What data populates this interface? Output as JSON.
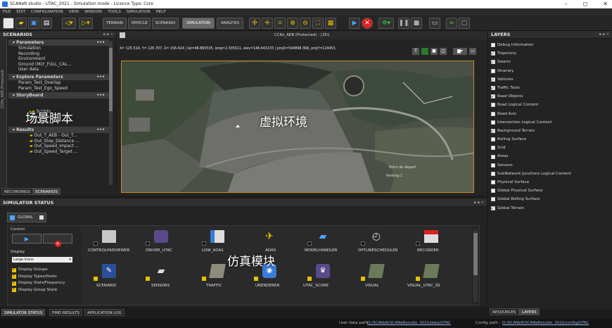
{
  "titlebar": {
    "text": "SCANeR studio - UTAC_2021 - Simulation mode - Licence Type: Core",
    "minimize": "–",
    "maximize": "◻",
    "close": "✕"
  },
  "menu": [
    "FILE",
    "EDIT",
    "CONFIGURATION",
    "VIEW",
    "WINDOW",
    "TOOLS",
    "SIMULATION",
    "HELP"
  ],
  "toolbar": {
    "modes": [
      "TERRAIN",
      "VEHICLE",
      "SCENARIO",
      "SIMULATION",
      "ANALYSIS"
    ],
    "active_mode": "SIMULATION"
  },
  "scenarios": {
    "title": "SCENARIOS",
    "side_label": "CCRs_AEB (Protected)",
    "parameters": {
      "label": "Parameters",
      "items": [
        "Simulation",
        "Recording",
        "Environment",
        "Ground (MLY_FULL_CAL...",
        "User data"
      ]
    },
    "explore": {
      "label": "Explore Parameters",
      "items": [
        "Param_Test_Overlap",
        "Param_Test_Ego_Speed"
      ]
    },
    "storyboard": {
      "label": "StoryBoard",
      "items": [
        "Scripts",
        "Forward",
        "Failure"
      ]
    },
    "results": {
      "label": "Results",
      "items": [
        "Out_T_AEB - Out_T...",
        "Out_Stop_Distance ...",
        "Out_Speed_Impact ...",
        "Out_Speed_Target ..."
      ]
    },
    "dots": "•••",
    "overlay": "场景脚本",
    "tabs": [
      "RECORDINGS",
      "SCENARIOS"
    ]
  },
  "viewport": {
    "title": "CCRs_AEB (Protected) - [3D]",
    "coords": "X= 125.514, Y= 126.707, Z= 156.424 | lat=48.865535, long=2.335011, elev=148.443233 | projX=594898.368, projY=124453.",
    "overlay": "虚拟环境",
    "map_text_1": "Point de départ",
    "map_text_2": "Parking 1"
  },
  "layers": {
    "title": "LAYERS",
    "items": [
      {
        "label": "Debug Information",
        "checked": false
      },
      {
        "label": "Trajectory",
        "checked": true
      },
      {
        "label": "Swarm",
        "checked": true
      },
      {
        "label": "Itinerary",
        "checked": false
      },
      {
        "label": "Vehicles",
        "checked": true
      },
      {
        "label": "Traffic Tools",
        "checked": true
      },
      {
        "label": "Road Objects",
        "checked": true
      },
      {
        "label": "Road Logical Content",
        "checked": false
      },
      {
        "label": "Road Axis",
        "checked": false
      },
      {
        "label": "Intersection Logical Content",
        "checked": false
      },
      {
        "label": "Background Terrain",
        "checked": true
      },
      {
        "label": "Rolling Surface",
        "checked": false
      },
      {
        "label": "Grid",
        "checked": false
      },
      {
        "label": "Areas",
        "checked": false
      },
      {
        "label": "Sensors",
        "checked": false
      },
      {
        "label": "SubNetwork Junctions Logical Content",
        "checked": false
      },
      {
        "label": "Physical Surface",
        "checked": false
      },
      {
        "label": "Global Physical Surface",
        "checked": false
      },
      {
        "label": "Global Rolling Surface",
        "checked": false
      },
      {
        "label": "Global Terrain",
        "checked": true
      }
    ],
    "tabs": [
      "RESOURCES",
      "LAYERS"
    ]
  },
  "simstatus": {
    "title": "SIMULATOR STATUS",
    "tab": "GLOBAL",
    "control_label": "Control",
    "display_label": "Display",
    "display_select": "Large Icons",
    "options": [
      "Display Groups",
      "Display Types/Hosts",
      "Display Stats/Frequency",
      "Display Group State"
    ],
    "overlay": "仿真模块",
    "modules_row1": [
      "CONTROLPADVIEWER",
      "DRIVER_UTAC",
      "LDW_ADAS",
      "ADAS",
      "MODELHANDLER",
      "OFFLINESCHEDULER",
      "RECORDER"
    ],
    "modules_row2": [
      "SCENARIO",
      "SENSORS",
      "TRAFFIC",
      "URENDERER",
      "UTAC_SCORE",
      "VISUAL",
      "VISUAL_UTAC_SS"
    ]
  },
  "bottom_tabs": [
    "SIMULATOR STATUS",
    "FIND RESULTS",
    "APPLICATION LOG"
  ],
  "status_bar": {
    "user_label": "User data path :",
    "user_path": "D:/SCANeR/SCANeRstudio_2021/data/UTAC",
    "config_label": "Config path :",
    "config_path": "D:/SCANeR/SCANeRstudio_2021/config/UTAC"
  }
}
